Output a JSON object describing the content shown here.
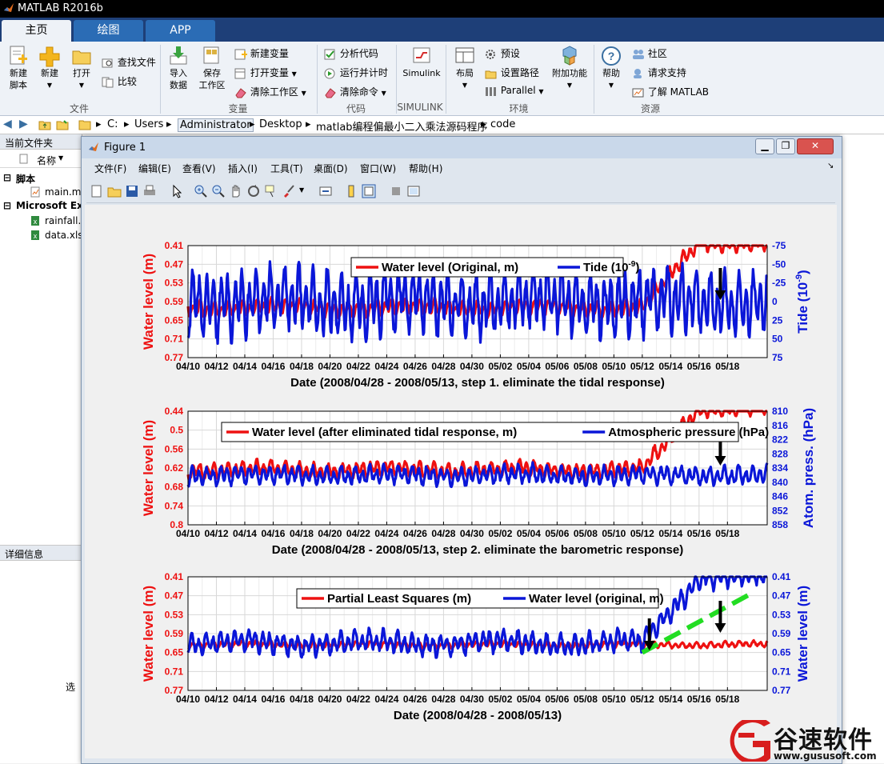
{
  "app": {
    "title": "MATLAB R2016b"
  },
  "tabs": [
    {
      "label": "主页"
    },
    {
      "label": "绘图"
    },
    {
      "label": "APP"
    }
  ],
  "ribbon": {
    "new_script": "新建\n脚本",
    "new": "新建",
    "open": "打开",
    "find_files": "查找文件",
    "compare": "比较",
    "import_data": "导入\n数据",
    "save_workspace": "保存\n工作区",
    "new_variable": "新建变量",
    "open_variable": "打开变量",
    "clear_workspace": "清除工作区",
    "analyze_code": "分析代码",
    "run_and_time": "运行并计时",
    "clear_commands": "清除命令",
    "simulink": "Simulink",
    "layout": "布局",
    "preferences": "预设",
    "set_path": "设置路径",
    "parallel": "Parallel",
    "addons": "附加功能",
    "help": "帮助",
    "community": "社区",
    "request_support": "请求支持",
    "learn_matlab": "了解 MATLAB",
    "sections": {
      "file": "文件",
      "variable": "变量",
      "code": "代码",
      "simulink": "SIMULINK",
      "environment": "环境",
      "resources": "资源"
    }
  },
  "address": {
    "segments": [
      "C:",
      "Users",
      "Administrator",
      "Desktop",
      "matlab编程偏最小二入乘法源码程序",
      "code"
    ]
  },
  "current_folder": {
    "title": "当前文件夹",
    "name_col": "名称",
    "groups": [
      {
        "label": "脚本",
        "files": [
          "main.m"
        ]
      },
      {
        "label": "Microsoft Exc",
        "files": [
          "rainfall.x",
          "data.xls"
        ]
      }
    ],
    "details_title": "详细信息",
    "select_hint": "选"
  },
  "figure": {
    "title": "Figure 1",
    "menu": [
      "文件(F)",
      "编辑(E)",
      "查看(V)",
      "插入(I)",
      "工具(T)",
      "桌面(D)",
      "窗口(W)",
      "帮助(H)"
    ]
  },
  "colors": {
    "red": "#ee1111",
    "blue": "#0a16d8",
    "green": "#22dd22",
    "tabbar": "#1e3f78"
  },
  "chart_data": [
    {
      "type": "line",
      "x_ticks": [
        "04/10",
        "04/12",
        "04/14",
        "04/16",
        "04/18",
        "04/20",
        "04/22",
        "04/24",
        "04/26",
        "04/28",
        "04/30",
        "05/02",
        "05/04",
        "05/06",
        "05/08",
        "05/10",
        "05/12",
        "05/14",
        "05/16",
        "05/18"
      ],
      "xlabel": "Date (2008/04/28 - 2008/05/13, step 1. eliminate the tidal response)",
      "ylabel": "Water level (m)",
      "ylabel2": "Tide (10",
      "ylabel2_sup": "-9",
      "ylabel2_end": ")",
      "y_ticks": [
        "0.41",
        "0.47",
        "0.53",
        "0.59",
        "0.65",
        "0.71",
        "0.77"
      ],
      "y2_ticks": [
        "-75",
        "-50",
        "-25",
        "0",
        "25",
        "50",
        "75"
      ],
      "ylim": [
        0.41,
        0.77
      ],
      "y2lim": [
        -75,
        75
      ],
      "y_reversed": true,
      "y2_reversed": false,
      "grid": true,
      "legend": [
        {
          "name": "Water level (Original, m)"
        },
        {
          "name": "Tide (10",
          "sup": "-9",
          "end": ")"
        }
      ],
      "legend_placement": "top-center",
      "series": [
        {
          "name": "Water level (Original, m)",
          "mean": 0.61,
          "amp": 0.025,
          "rise_from": "05/12",
          "rise_to": 0.4,
          "axis": "left"
        },
        {
          "name": "Tide (10-9)",
          "mean": 0,
          "amp": 45,
          "axis": "right"
        }
      ],
      "annotation": {
        "type": "arrow",
        "at": "05/17"
      }
    },
    {
      "type": "line",
      "x_ticks": [
        "04/10",
        "04/12",
        "04/14",
        "04/16",
        "04/18",
        "04/20",
        "04/22",
        "04/24",
        "04/26",
        "04/28",
        "04/30",
        "05/02",
        "05/04",
        "05/06",
        "05/08",
        "05/10",
        "05/12",
        "05/14",
        "05/16",
        "05/18"
      ],
      "xlabel": "Date (2008/04/28 - 2008/05/13, step 2. eliminate the barometric response)",
      "ylabel": "Water level (m)",
      "ylabel2": "Atom. press. (hPa)",
      "y_ticks": [
        "0.44",
        "0.5",
        "0.56",
        "0.62",
        "0.68",
        "0.74",
        "0.8"
      ],
      "y2_ticks": [
        "810",
        "816",
        "822",
        "828",
        "834",
        "840",
        "846",
        "852",
        "858"
      ],
      "ylim": [
        0.44,
        0.8
      ],
      "y2lim": [
        810,
        858
      ],
      "y_reversed": true,
      "y2_reversed": true,
      "grid": true,
      "legend": [
        {
          "name": "Water level (after eliminated tidal response, m)"
        },
        {
          "name": "Atmospheric pressure (hPa)"
        }
      ],
      "legend_placement": "top-center",
      "series": [
        {
          "name": "Water level (after eliminated tidal response, m)",
          "mean": 0.625,
          "amp": 0.025,
          "rise_from": "05/12",
          "rise_to": 0.43,
          "axis": "left"
        },
        {
          "name": "Atmospheric pressure (hPa)",
          "mean": 837,
          "amp": 4,
          "axis": "right"
        }
      ],
      "annotation": {
        "type": "arrow",
        "at": "05/17"
      }
    },
    {
      "type": "line",
      "x_ticks": [
        "04/10",
        "04/12",
        "04/14",
        "04/16",
        "04/18",
        "04/20",
        "04/22",
        "04/24",
        "04/26",
        "04/28",
        "04/30",
        "05/02",
        "05/04",
        "05/06",
        "05/08",
        "05/10",
        "05/12",
        "05/14",
        "05/16",
        "05/18"
      ],
      "xlabel": "Date (2008/04/28 - 2008/05/13)",
      "ylabel": "Water level (m)",
      "ylabel2": "Water level (m)",
      "y_ticks": [
        "0.41",
        "0.47",
        "0.53",
        "0.59",
        "0.65",
        "0.71",
        "0.77"
      ],
      "y2_ticks": [
        "0.41",
        "0.47",
        "0.53",
        "0.59",
        "0.65",
        "0.71",
        "0.77"
      ],
      "ylim": [
        0.41,
        0.77
      ],
      "y2lim": [
        0.41,
        0.77
      ],
      "y_reversed": true,
      "y2_reversed": true,
      "grid": true,
      "legend": [
        {
          "name": "Partial Least Squares (m)"
        },
        {
          "name": "Water level (original, m)"
        }
      ],
      "legend_placement": "top-center",
      "series": [
        {
          "name": "Partial Least Squares (m)",
          "mean": 0.625,
          "amp": 0.01,
          "axis": "left"
        },
        {
          "name": "Water level (original, m)",
          "mean": 0.62,
          "amp": 0.035,
          "rise_from": "05/12",
          "rise_to": 0.41,
          "axis": "left"
        }
      ],
      "trend": {
        "from": [
          "05/12",
          0.65
        ],
        "to": [
          "05/19",
          0.46
        ]
      },
      "annotation": {
        "type": "arrow",
        "at": [
          "05/12",
          "05/17"
        ]
      }
    }
  ],
  "watermark": {
    "brand": "谷速软件",
    "url": "www.gususoft.com"
  }
}
